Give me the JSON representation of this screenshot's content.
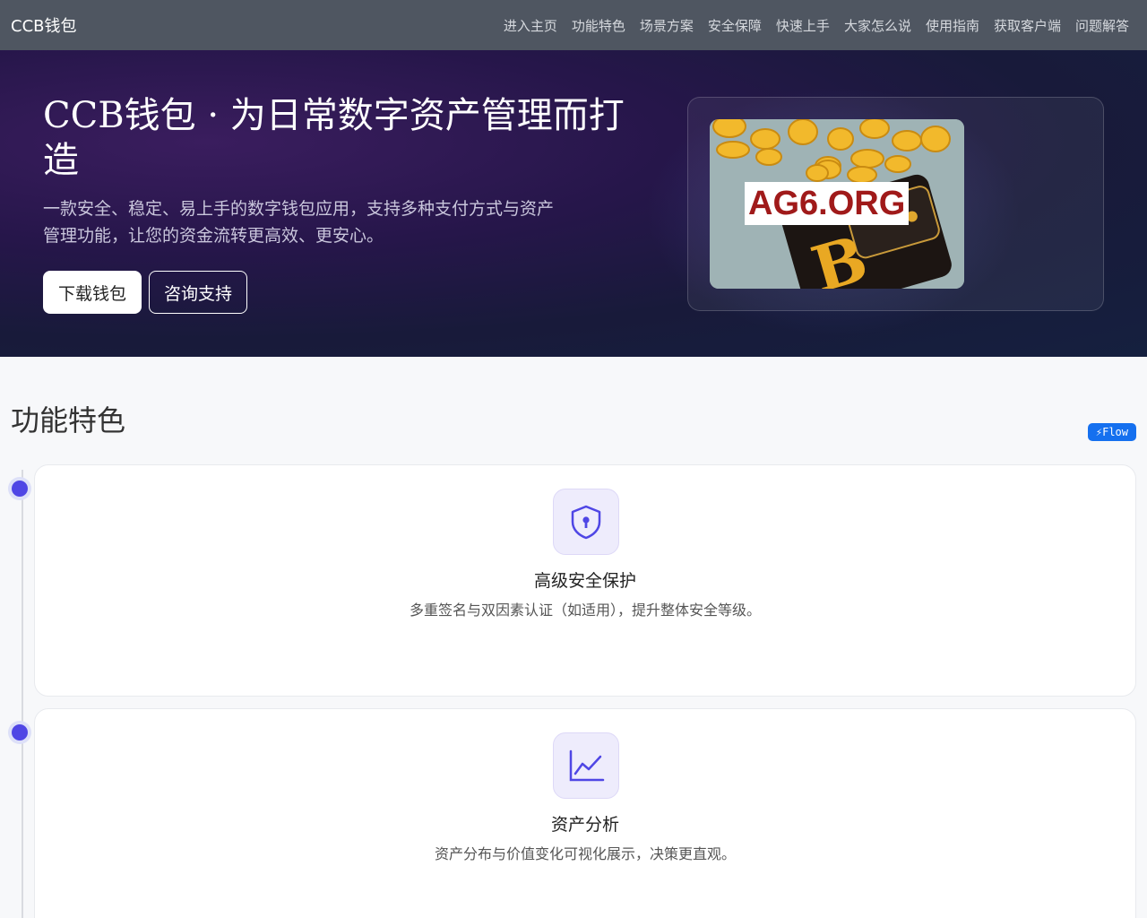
{
  "nav": {
    "brand": "CCB钱包",
    "links": [
      "进入主页",
      "功能特色",
      "场景方案",
      "安全保障",
      "快速上手",
      "大家怎么说",
      "使用指南",
      "获取客户端",
      "问题解答"
    ]
  },
  "hero": {
    "title": "CCB钱包 · 为日常数字资产管理而打造",
    "subtitle": "一款安全、稳定、易上手的数字钱包应用，支持多种支付方式与资产管理功能，让您的资金流转更高效、更安心。",
    "primary_button": "下载钱包",
    "secondary_button": "咨询支持",
    "image_overlay_text": "AG6.ORG"
  },
  "features": {
    "title": "功能特色",
    "badge": "⚡Flow",
    "items": [
      {
        "icon": "shield-lock-icon",
        "title": "高级安全保护",
        "desc": "多重签名与双因素认证（如适用），提升整体安全等级。"
      },
      {
        "icon": "line-chart-icon",
        "title": "资产分析",
        "desc": "资产分布与价值变化可视化展示，决策更直观。"
      }
    ]
  },
  "colors": {
    "accent": "#4f46e5",
    "nav_bg": "#4f5661",
    "badge": "#1570ef"
  }
}
